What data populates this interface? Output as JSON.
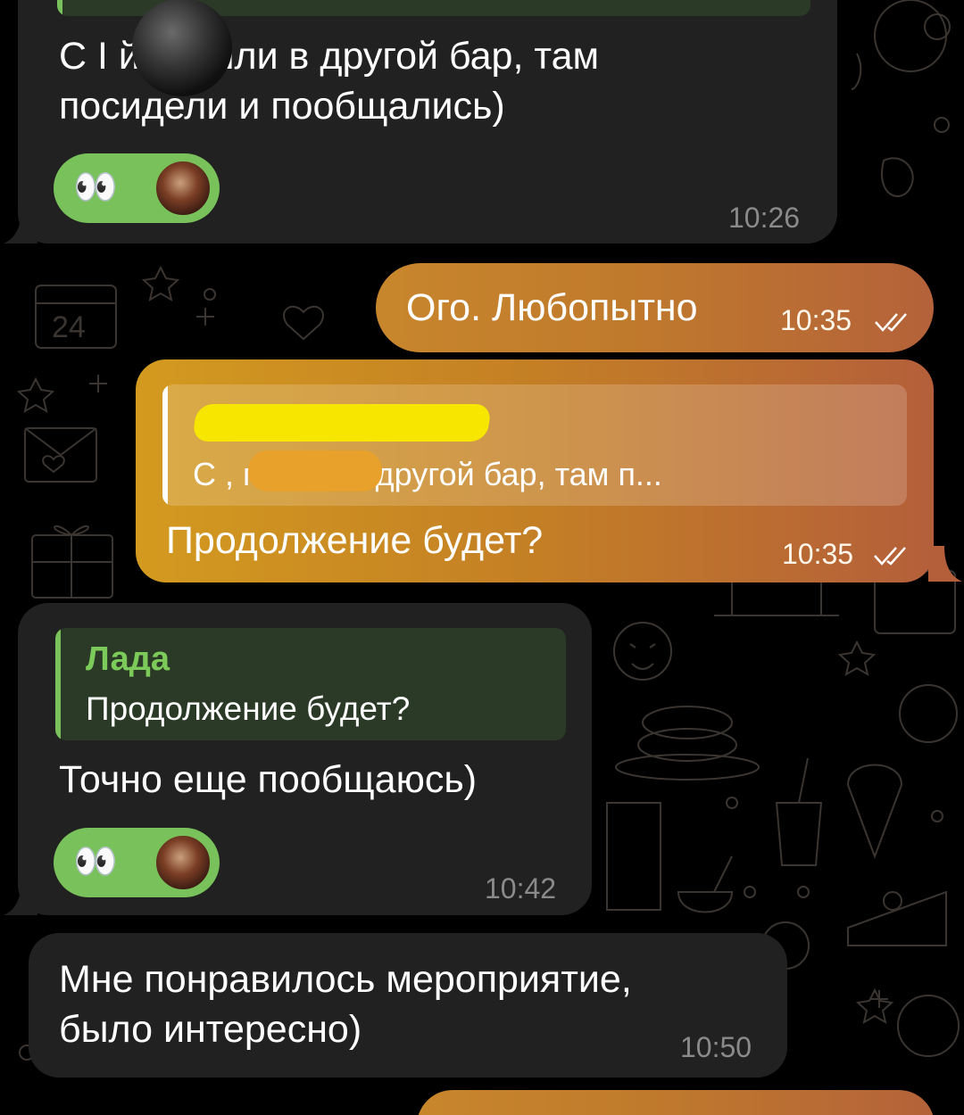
{
  "colors": {
    "incoming_bubble": "#212121",
    "outgoing_start": "#c8862c",
    "outgoing_end": "#b4623a",
    "reply_accent_green": "#79c25b",
    "reply_name_green": "#7ccb5a",
    "reaction_green": "#79c25b",
    "time_gray": "#8a8a8a"
  },
  "messages": [
    {
      "direction": "incoming",
      "text_lines": [
        "С I        й, пошли в другой бар, там",
        "посидели и пообщались)"
      ],
      "reactions": {
        "emoji": "👀",
        "avatar": "user-avatar"
      },
      "time": "10:26"
    },
    {
      "direction": "outgoing",
      "text": "Ого. Любопытно",
      "time": "10:35",
      "status": "double-check-icon"
    },
    {
      "direction": "outgoing",
      "reply": {
        "author": "",
        "text": "С         , пошли в другой бар, там п..."
      },
      "text": "Продолжение будет?",
      "time": "10:35",
      "status": "double-check-icon"
    },
    {
      "direction": "incoming",
      "reply": {
        "author": "Лада",
        "text": "Продолжение будет?"
      },
      "text": "Точно еще пообщаюсь)",
      "reactions": {
        "emoji": "👀",
        "avatar": "user-avatar"
      },
      "time": "10:42"
    },
    {
      "direction": "incoming",
      "text_lines": [
        "Мне понравилось мероприятие,",
        "было интересно)"
      ],
      "time": "10:50"
    }
  ]
}
